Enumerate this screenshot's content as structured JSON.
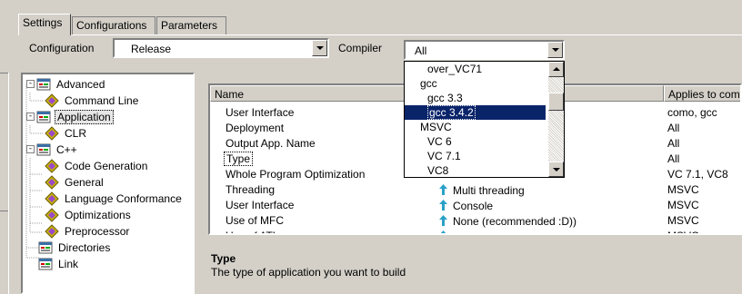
{
  "tabs": [
    {
      "label": "Settings",
      "active": true
    },
    {
      "label": "Configurations",
      "active": false
    },
    {
      "label": "Parameters",
      "active": false
    }
  ],
  "configuration": {
    "label": "Configuration",
    "value": "Release"
  },
  "compiler": {
    "label": "Compiler",
    "value": "All"
  },
  "tree": [
    {
      "label": "Advanced",
      "icon": "settings-group-icon",
      "expander": "-"
    },
    {
      "label": "Command Line",
      "icon": "property-page-icon"
    },
    {
      "label": "Application",
      "icon": "settings-group-icon",
      "expander": "-",
      "selected": true
    },
    {
      "label": "CLR",
      "icon": "property-page-icon"
    },
    {
      "label": "C++",
      "icon": "settings-group-icon",
      "expander": "-"
    },
    {
      "label": "Code Generation",
      "icon": "property-page-icon"
    },
    {
      "label": "General",
      "icon": "property-page-icon"
    },
    {
      "label": "Language Conformance",
      "icon": "property-page-icon"
    },
    {
      "label": "Optimizations",
      "icon": "property-page-icon"
    },
    {
      "label": "Preprocessor",
      "icon": "property-page-icon"
    },
    {
      "label": "Directories",
      "icon": "settings-group-icon"
    },
    {
      "label": "Link",
      "icon": "settings-group-icon"
    }
  ],
  "columns": {
    "name": "Name",
    "value": "",
    "applies": "Applies to com"
  },
  "rows": [
    {
      "name": "User Interface",
      "value": "",
      "applies": "como, gcc"
    },
    {
      "name": "Deployment",
      "value": "",
      "applies": "All"
    },
    {
      "name": "Output App. Name",
      "value": "",
      "applies": "All"
    },
    {
      "name": "Type",
      "value": "",
      "applies": "All"
    },
    {
      "name": "Whole Program Optimization",
      "value": "",
      "applies": "VC 7.1, VC8"
    },
    {
      "name": "Threading",
      "value": "Multi threading",
      "applies": "MSVC"
    },
    {
      "name": "User Interface",
      "value": "Console",
      "applies": "MSVC"
    },
    {
      "name": "Use of MFC",
      "value": "None (recommended :D))",
      "applies": "MSVC"
    },
    {
      "name": "Use of ATL",
      "value": "",
      "applies": "MSVC"
    }
  ],
  "compiler_options": [
    {
      "label": "over_VC71",
      "level": 2
    },
    {
      "label": "gcc",
      "level": 1
    },
    {
      "label": "gcc 3.3",
      "level": 2
    },
    {
      "label": "gcc 3.4.2",
      "level": 2,
      "selected": true
    },
    {
      "label": "MSVC",
      "level": 1
    },
    {
      "label": "VC 6",
      "level": 2
    },
    {
      "label": "VC 7.1",
      "level": 2
    },
    {
      "label": "VC8",
      "level": 2
    }
  ],
  "description": {
    "title": "Type",
    "text": "The type of application you want to build"
  },
  "colors": {
    "selection": "#0a246a",
    "face": "#d4d0c8",
    "up_arrow": "#2aa0c8"
  }
}
